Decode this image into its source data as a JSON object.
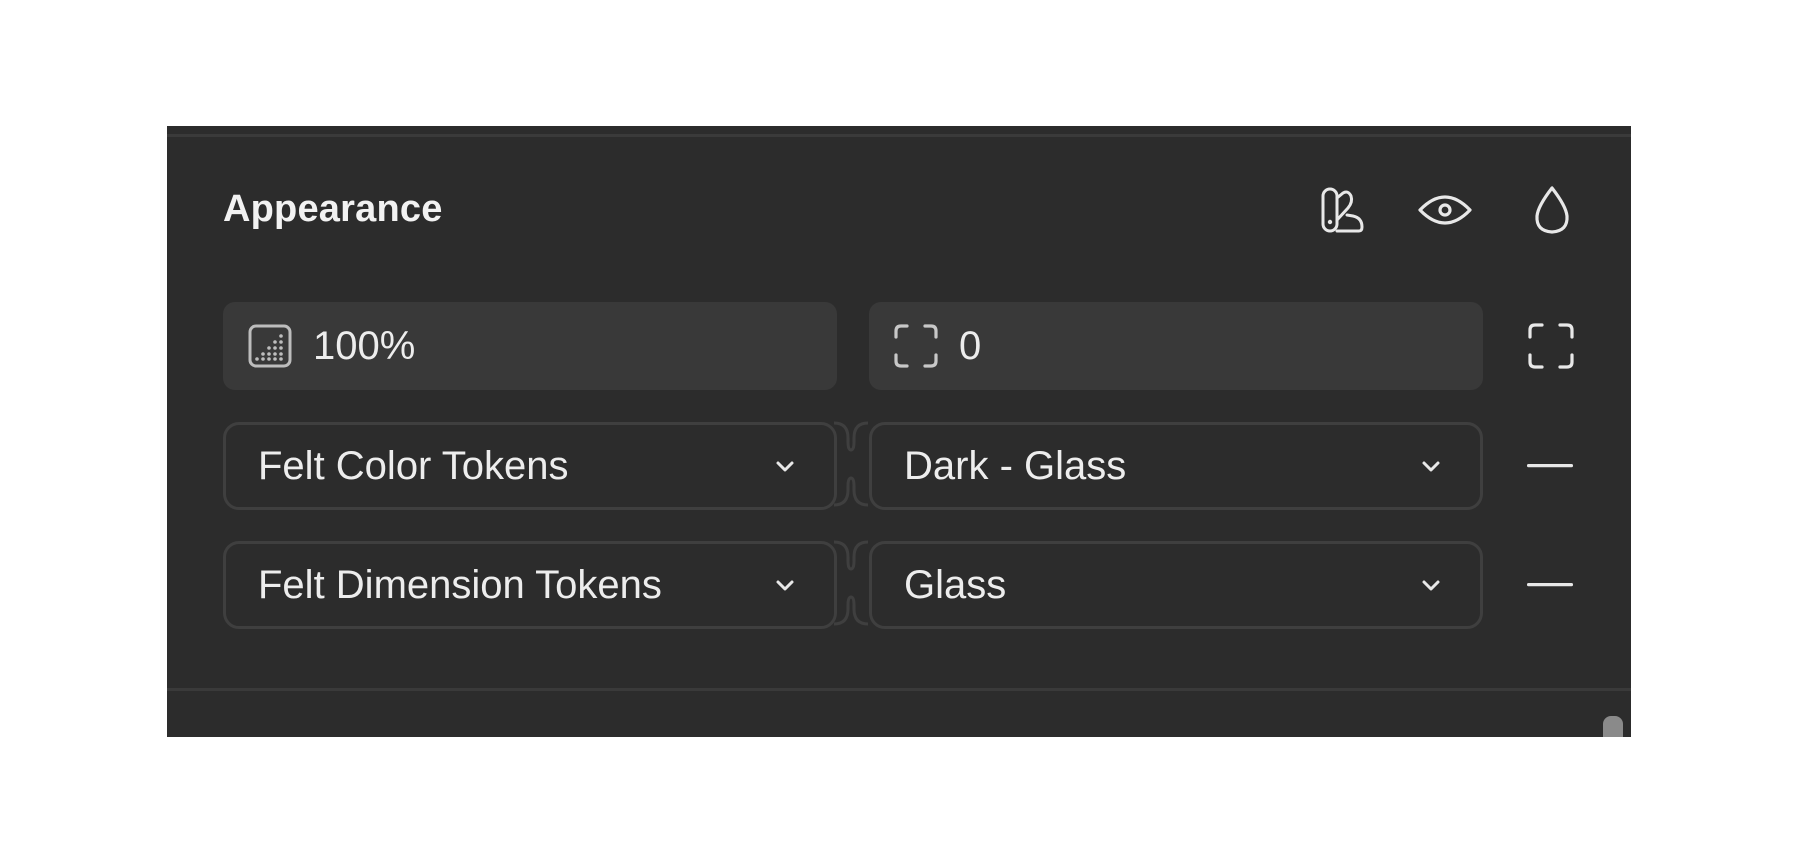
{
  "section": {
    "title": "Appearance",
    "header_icons": [
      "variable-mode-icon",
      "eye-icon",
      "drop-icon"
    ]
  },
  "opacity": {
    "icon": "opacity-icon",
    "value": "100%"
  },
  "corner_radius": {
    "icon": "corner-radius-icon",
    "value": "0"
  },
  "independent_corners_icon": "expand-corners-icon",
  "variable_modes": [
    {
      "collection": "Felt Color Tokens",
      "mode": "Dark - Glass"
    },
    {
      "collection": "Felt Dimension Tokens",
      "mode": "Glass"
    }
  ],
  "colors": {
    "panel_bg": "#2c2c2c",
    "field_bg": "#393939",
    "border": "#3f3f3f",
    "text": "#ededed"
  }
}
